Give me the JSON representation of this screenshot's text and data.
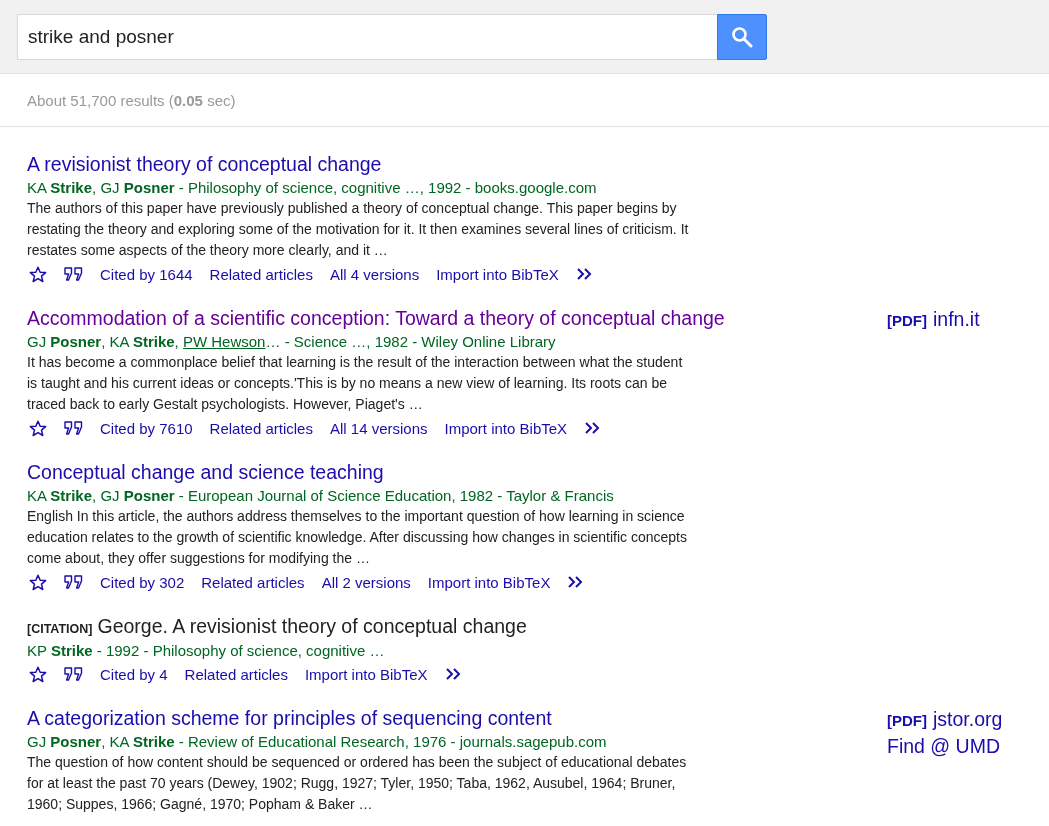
{
  "search": {
    "value": "strike and posner"
  },
  "stats": "About 51,700 results (**0.05** sec)",
  "results": [
    {
      "kind": "article",
      "visited": false,
      "title": "A revisionist theory of conceptual change",
      "meta": [
        {
          "kind": "plain",
          "text": "KA "
        },
        {
          "kind": "bold",
          "text": "Strike"
        },
        {
          "kind": "plain",
          "text": ", GJ "
        },
        {
          "kind": "bold",
          "text": "Posner"
        },
        {
          "kind": "plain",
          "text": " - Philosophy of science, cognitive …, 1992 - books.google.com"
        }
      ],
      "snippet": "The authors of this paper have previously published a theory of conceptual change. This paper begins by restating the theory and exploring some of the motivation for it. It then examines several lines of criticism. It restates some aspects of the theory more clearly, and it …",
      "links": [
        "Cited by 1644",
        "Related articles",
        "All 4 versions",
        "Import into BibTeX"
      ]
    },
    {
      "kind": "article",
      "visited": true,
      "title": "Accommodation of a scientific conception: Toward a theory of conceptual change",
      "meta": [
        {
          "kind": "plain",
          "text": "GJ "
        },
        {
          "kind": "bold",
          "text": "Posner"
        },
        {
          "kind": "plain",
          "text": ", KA "
        },
        {
          "kind": "bold",
          "text": "Strike"
        },
        {
          "kind": "plain",
          "text": ", "
        },
        {
          "kind": "link",
          "text": "PW Hewson"
        },
        {
          "kind": "plain",
          "text": "… - Science …, 1982 - Wiley Online Library"
        }
      ],
      "snippet": "It has become a commonplace belief that learning is the result of the interaction between what the student is taught and his current ideas or concepts.'This is by no means a new view of learning. Its roots can be traced back to early Gestalt psychologists. However, Piaget's …",
      "links": [
        "Cited by 7610",
        "Related articles",
        "All 14 versions",
        "Import into BibTeX"
      ],
      "side": [
        {
          "tag": "[PDF]",
          "text": "infn.it"
        }
      ]
    },
    {
      "kind": "article",
      "visited": false,
      "title": "Conceptual change and science teaching",
      "meta": [
        {
          "kind": "plain",
          "text": "KA "
        },
        {
          "kind": "bold",
          "text": "Strike"
        },
        {
          "kind": "plain",
          "text": ", GJ "
        },
        {
          "kind": "bold",
          "text": "Posner"
        },
        {
          "kind": "plain",
          "text": " - European Journal of Science Education, 1982 - Taylor & Francis"
        }
      ],
      "snippet": "English In this article, the authors address themselves to the important question of how learning in science education relates to the growth of scientific knowledge. After discussing how changes in scientific concepts come about, they offer suggestions for modifying the …",
      "links": [
        "Cited by 302",
        "Related articles",
        "All 2 versions",
        "Import into BibTeX"
      ]
    },
    {
      "kind": "citation",
      "tag": "[CITATION]",
      "title": "George. A revisionist theory of conceptual change",
      "meta": [
        {
          "kind": "plain",
          "text": "KP "
        },
        {
          "kind": "bold",
          "text": "Strike"
        },
        {
          "kind": "plain",
          "text": " - 1992 - Philosophy of science, cognitive …"
        }
      ],
      "links": [
        "Cited by 4",
        "Related articles",
        "Import into BibTeX"
      ]
    },
    {
      "kind": "article",
      "visited": false,
      "title": "A categorization scheme for principles of sequencing content",
      "meta": [
        {
          "kind": "plain",
          "text": "GJ "
        },
        {
          "kind": "bold",
          "text": "Posner"
        },
        {
          "kind": "plain",
          "text": ", KA "
        },
        {
          "kind": "bold",
          "text": "Strike"
        },
        {
          "kind": "plain",
          "text": " - Review of Educational Research, 1976 - journals.sagepub.com"
        }
      ],
      "snippet": "The question of how content should be sequenced or ordered has been the subject of educational debates for at least the past 70 years (Dewey, 1902; Rugg, 1927; Tyler, 1950; Taba, 1962, Ausubel, 1964; Bruner, 1960; Suppes, 1966; Gagné, 1970; Popham & Baker …",
      "side": [
        {
          "tag": "[PDF]",
          "text": "jstor.org"
        },
        {
          "text": "Find @ UMD"
        }
      ]
    }
  ]
}
